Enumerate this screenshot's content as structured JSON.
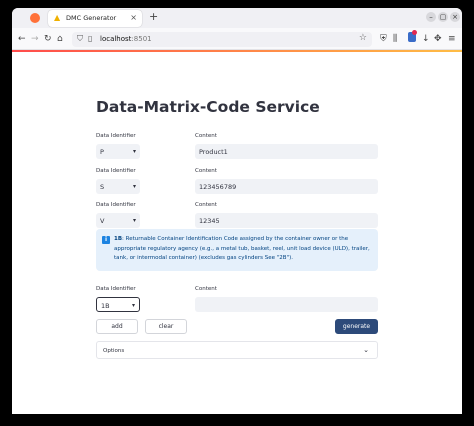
{
  "browser": {
    "tab_title": "DMC Generator",
    "tab_close": "×",
    "new_tab": "+",
    "url_host": "localhost",
    "url_port": ":8501",
    "window_buttons": [
      "–",
      "▢",
      "×"
    ]
  },
  "icons": {
    "back": "←",
    "forward": "→",
    "reload": "↻",
    "home": "⌂",
    "star": "☆",
    "menu": "≡"
  },
  "page": {
    "title": "Data-Matrix-Code Service",
    "rows": [
      {
        "di_label": "Data Identifier",
        "di_value": "P",
        "content_label": "Content",
        "content_value": "Product1"
      },
      {
        "di_label": "Data Identifier",
        "di_value": "S",
        "content_label": "Content",
        "content_value": "123456789"
      },
      {
        "di_label": "Data Identifier",
        "di_value": "V",
        "content_label": "Content",
        "content_value": "12345"
      }
    ],
    "info": {
      "code": "1B",
      "text": ": Returnable Container Identification Code assigned by the container owner or the appropriate regulatory agency (e.g., a metal tub, basket, reel, unit load device (ULD), trailer, tank, or intermodal container) (excludes gas cylinders See \"2B\")."
    },
    "new_row": {
      "di_label": "Data Identifier",
      "di_value": "1B",
      "content_label": "Content",
      "content_value": ""
    },
    "buttons": {
      "add": "add",
      "clear": "clear",
      "generate": "generate"
    },
    "expander_label": "Options",
    "caret": "▾",
    "chevron": "⌄"
  },
  "colors": {
    "primary_button": "#2d4a7a",
    "info_bg": "#e5f0fb",
    "info_text": "#004280",
    "input_bg": "#f0f2f6"
  }
}
